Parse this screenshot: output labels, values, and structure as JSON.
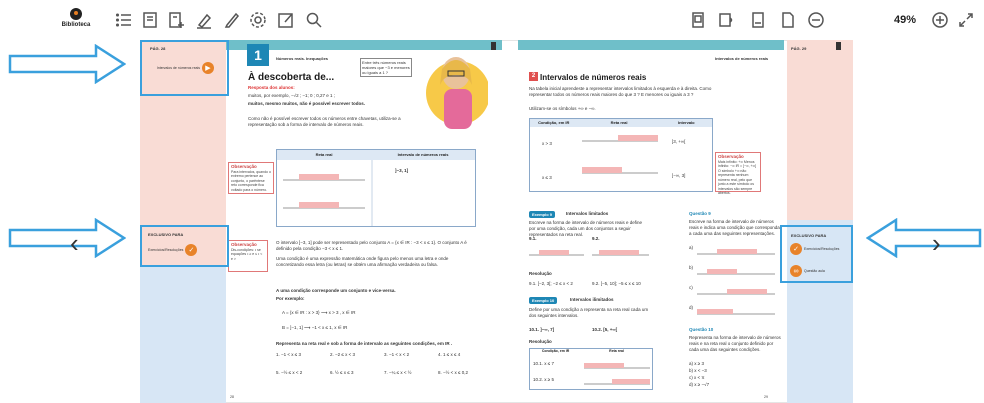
{
  "toolbar": {
    "library_label": "Biblioteca",
    "zoom_level": "49%",
    "icons": [
      "list-icon",
      "book-icon",
      "add-note-icon",
      "highlight-icon",
      "pencil-icon",
      "settings-icon",
      "edit-icon",
      "search-icon",
      "single-page-icon",
      "audio-icon",
      "bookmark-page-icon",
      "blank-page-icon",
      "zoom-out-icon",
      "zoom-in-icon",
      "expand-icon"
    ]
  },
  "left_page": {
    "chapter_number": "1",
    "header": "Números reais. Inequações",
    "title": "À descoberta de...",
    "subtitle": "Resposta dos alunos:",
    "bullet1": "muitos, por exemplo, −√2 ; −1; 0 ; 0,27 e 1 ;",
    "bullet2": "muitos, mesmo muitos, não é possível escrever todos.",
    "para1": "Como não é possível escrever todos os números entre chavetas, utiliza-se a representação sob a forma de intervalo de números reais.",
    "speech": "Entre três números reais maiores que −3 e menores ou iguais a 1 ?",
    "obs1_title": "Observação",
    "obs1_text": "Para intervalos, quando o extremo pertence ao conjunto, o parêntese reto corresponde fica voltado para o número.",
    "obs2_title": "Observação",
    "obs2_text": "Dis-condições: • se equações • ≥ e ≤ • < e >",
    "table_head1": "Reta real",
    "table_head2": "Intervalo de números reais",
    "interval_text": "]−3, 1]",
    "para2": "O intervalo ]−3, 1] pode ser representado pelo conjunto A = {x ∈ IR : −3 < x ≤ 1}. O conjunto A é definido pela condição −3 < x ≤ 1.",
    "para3": "Uma condição é uma expressão matemática onde figura pelo menos uma letra e onde concretizando essa letra (ou letras) se obtém uma afirmação verdadeira ou falsa.",
    "para4": "A uma condição corresponde um conjunto e vice-versa.",
    "por_exemplo": "Por exemplo:",
    "example1": "A = {x ∈ IR : x > 3} ⟶ x > 3 , x ∈ IR",
    "example2": "B = ]−1, 1] ⟶ −1 < x ≤ 1, x ∈ IR",
    "exercise_line": "Representa na reta real e sob a forma de intervalo as seguintes condições, em IR .",
    "exercises_row1": [
      "1. −1 < x ≤ 3",
      "2. −2 ≤ x < 3",
      "3. −1 < x < 2",
      "4. 1 ≤ x ≤ 4"
    ],
    "exercises_row2": [
      "5. −½ ≤ x < 2",
      "6. ½ ≤ x ≤ 3",
      "7. −¼ ≤ x < ½",
      "8. −½ < x ≤ 0,2"
    ],
    "page_number": "28"
  },
  "right_page": {
    "header": "Intervalos de números reais",
    "section_num": "2",
    "title": "Intervalos de números reais",
    "intro": "Na tabela inicial aprendeste a representar intervalos limitados à esquerda e à direita. Como representar todos os números reais maiores do que 3 ? E menores ou iguais a 3 ?",
    "intro2": "Utilizam-se os símbolos +∞ e −∞.",
    "table_heads": [
      "Condição, em IR",
      "Reta real",
      "Intervalo"
    ],
    "row1_cond": "x > 3",
    "row1_interval": "]3, +∞[",
    "row2_cond": "x ≤ 3",
    "row2_interval": "]−∞, 3]",
    "obs_title": "Observação",
    "obs_text": "Mais infinito: +∞ Menos infinito: −∞ IR = ]−∞, +∞[ O símbolo +∞ não representa nenhum número real, pelo que junto a este símbolo os intervalos são sempre abertos.",
    "ex9_label": "Exemplo 9",
    "ex9_title": "Intervalos limitados",
    "ex9_text": "Escreve na forma de intervalo de números reais e define por uma condição, cada um dos conjuntos a seguir representados na reta real.",
    "ex9_items": [
      "9.1.",
      "9.2."
    ],
    "resolucao": "Resolução",
    "res9_1": "9.1. [−2, 3[; −2 ≤ x < 2",
    "res9_2": "9.2. [−5, 10]; −5 ≤ x ≤ 10",
    "ex10_label": "Exemplo 10",
    "ex10_title": "Intervalos ilimitados",
    "ex10_text": "Define por uma condição a representa na reta real cada um dos seguintes intervalos.",
    "ex10_items": [
      "10.1. ]−∞, 7]",
      "10.2. [5, +∞["
    ],
    "res10_heads": [
      "Condição, em IR",
      "Reta real"
    ],
    "res10_rows": [
      "10.1. x ≤ 7",
      "10.2. x ≥ 5"
    ],
    "q9_title": "Questão 9",
    "q9_text": "Escreve na forma de intervalo de números reais e indica uma condição que corresponda a cada uma das seguintes representações.",
    "q9_items": [
      "a)",
      "b)",
      "c)",
      "d)"
    ],
    "q10_title": "Questão 10",
    "q10_text": "Representa na forma de intervalo de números reais e na reta real o conjunto definido por cada uma das seguintes condições.",
    "q10_items": [
      "a) x ≥ 3",
      "b) x < −3",
      "c) x < π",
      "d) x ≥ −√7"
    ],
    "page_number": "29"
  },
  "left_strip": {
    "top_label": "PÁG. 28",
    "resource_label": "Intervalos de números reais",
    "exclusive_label": "EXCLUSIVO PARA",
    "resource2_label": "Exercícios/Resoluções"
  },
  "right_strip": {
    "top_label": "PÁG. 29",
    "exclusive_label": "EXCLUSIVO PARA",
    "resource1_label": "Exercícios/Resoluções",
    "resource2_label": "Questão aula"
  },
  "colors": {
    "accent_blue": "#3aa0dd",
    "teal": "#6fbfc9",
    "orange": "#e8832a",
    "pink_strip": "#f9dcd5"
  }
}
